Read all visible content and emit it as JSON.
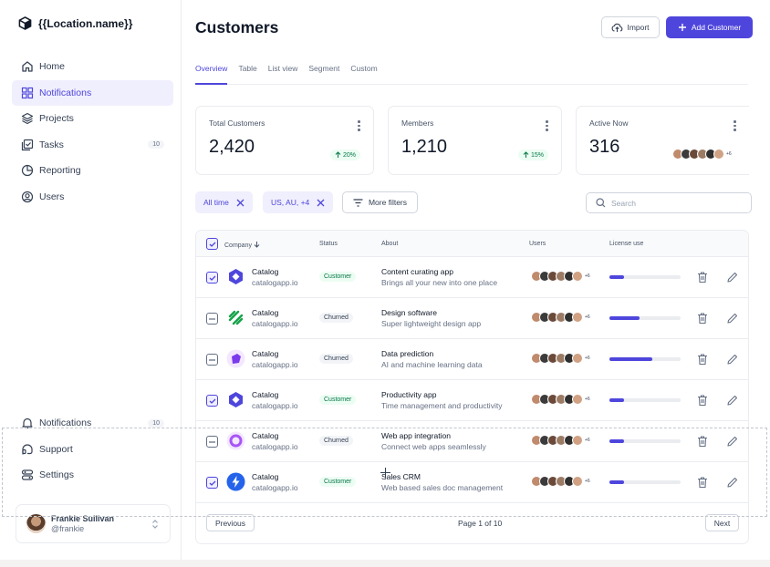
{
  "app": {
    "title": "{{Location.name}}"
  },
  "sidebar": {
    "items": [
      {
        "label": "Home",
        "icon": "home-icon",
        "active": false
      },
      {
        "label": "Notifications",
        "icon": "grid-icon",
        "active": true
      },
      {
        "label": "Projects",
        "icon": "layers-icon",
        "active": false
      },
      {
        "label": "Tasks",
        "icon": "tasks-icon",
        "active": false,
        "count": "10"
      },
      {
        "label": "Reporting",
        "icon": "pie-chart-icon",
        "active": false
      },
      {
        "label": "Users",
        "icon": "user-circle-icon",
        "active": false
      }
    ],
    "bottom_items": [
      {
        "label": "Notifications",
        "icon": "bell-icon",
        "count": "10"
      },
      {
        "label": "Support",
        "icon": "support-icon"
      },
      {
        "label": "Settings",
        "icon": "settings-icon"
      }
    ],
    "user": {
      "name": "Frankie Sullivan",
      "handle": "@frankie"
    }
  },
  "header": {
    "title": "Customers",
    "import_label": "Import",
    "add_label": "Add Customer"
  },
  "tabs": [
    "Overview",
    "Table",
    "List view",
    "Segment",
    "Custom"
  ],
  "active_tab": "Overview",
  "stats": [
    {
      "label": "Total Customers",
      "value": "2,420",
      "change": "20%"
    },
    {
      "label": "Members",
      "value": "1,210",
      "change": "15%"
    },
    {
      "label": "Active Now",
      "value": "316",
      "avatars_more": "+6"
    }
  ],
  "filters": {
    "chips": [
      "All time",
      "US, AU, +4"
    ],
    "more_label": "More filters",
    "search_placeholder": "Search"
  },
  "table": {
    "columns": [
      "Company",
      "Status",
      "About",
      "Users",
      "License use"
    ],
    "rows": [
      {
        "checked": true,
        "name": "Catalog",
        "url": "catalogapp.io",
        "status": "Customer",
        "about_title": "Content curating app",
        "about_sub": "Brings all your new into one place",
        "users_more": "+6",
        "license": 0.2,
        "logo": "hexagon-logo",
        "logo_color": "#4e46dc"
      },
      {
        "checked": false,
        "name": "Catalog",
        "url": "catalogapp.io",
        "status": "Churned",
        "about_title": "Design software",
        "about_sub": "Super lightweight design app",
        "users_more": "+6",
        "license": 0.42,
        "logo": "stripes-logo",
        "logo_color": "#17a34a"
      },
      {
        "checked": false,
        "name": "Catalog",
        "url": "catalogapp.io",
        "status": "Churned",
        "about_title": "Data prediction",
        "about_sub": "AI and machine learning data",
        "users_more": "+6",
        "license": 0.6,
        "logo": "cube-logo",
        "logo_color": "#7c3aed"
      },
      {
        "checked": true,
        "name": "Catalog",
        "url": "catalogapp.io",
        "status": "Customer",
        "about_title": "Productivity app",
        "about_sub": "Time management and productivity",
        "users_more": "+6",
        "license": 0.2,
        "logo": "hexagon-logo",
        "logo_color": "#4e46dc"
      },
      {
        "checked": false,
        "name": "Catalog",
        "url": "catalogapp.io",
        "status": "Churned",
        "about_title": "Web app integration",
        "about_sub": "Connect web apps seamlessly",
        "users_more": "+6",
        "license": 0.2,
        "logo": "ring-logo",
        "logo_color": "#a855f7"
      },
      {
        "checked": true,
        "name": "Catalog",
        "url": "catalogapp.io",
        "status": "Customer",
        "about_title": "Sales CRM",
        "about_sub": "Web based sales doc management",
        "users_more": "+6",
        "license": 0.2,
        "logo": "bolt-logo",
        "logo_color": "#2563eb"
      }
    ]
  },
  "pagination": {
    "previous": "Previous",
    "info": "Page 1 of 10",
    "next": "Next"
  }
}
